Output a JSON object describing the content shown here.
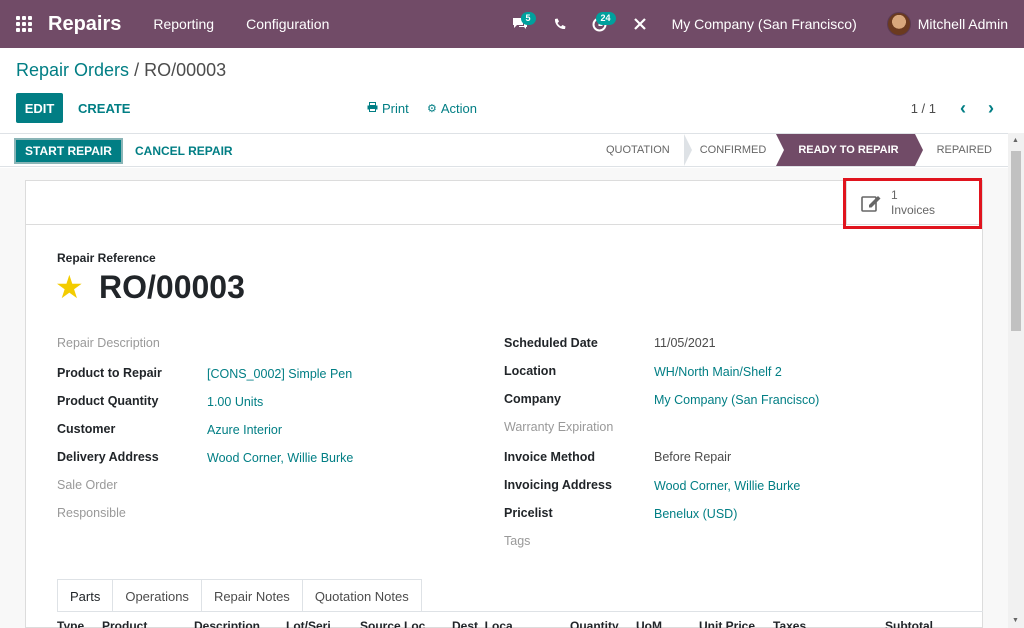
{
  "navbar": {
    "app_title": "Repairs",
    "menu": [
      "Reporting",
      "Configuration"
    ],
    "messages_badge": "5",
    "activities_badge": "24",
    "company": "My Company (San Francisco)",
    "user": "Mitchell Admin"
  },
  "breadcrumb": {
    "parent": "Repair Orders",
    "separator": "/",
    "current": "RO/00003"
  },
  "toolbar": {
    "edit": "EDIT",
    "create": "CREATE",
    "print": "Print",
    "action": "Action",
    "pager": "1 / 1"
  },
  "statusbar": {
    "start_repair": "START REPAIR",
    "cancel_repair": "CANCEL REPAIR",
    "stages": [
      {
        "label": "QUOTATION",
        "active": false
      },
      {
        "label": "CONFIRMED",
        "active": false
      },
      {
        "label": "READY TO REPAIR",
        "active": true
      },
      {
        "label": "REPAIRED",
        "active": false
      }
    ]
  },
  "smart_button": {
    "count": "1",
    "label": "Invoices"
  },
  "form": {
    "reference_label": "Repair Reference",
    "reference": "RO/00003",
    "left": [
      {
        "label": "Repair Description",
        "value": "",
        "muted": true,
        "link": false
      },
      {
        "label": "Product to Repair",
        "value": "[CONS_0002] Simple Pen",
        "muted": false,
        "link": true
      },
      {
        "label": "Product Quantity",
        "value": "1.00",
        "unit": "Units",
        "muted": false,
        "link": false
      },
      {
        "label": "Customer",
        "value": "Azure Interior",
        "muted": false,
        "link": true
      },
      {
        "label": "Delivery Address",
        "value": "Wood Corner, Willie Burke",
        "muted": false,
        "link": true
      },
      {
        "label": "Sale Order",
        "value": "",
        "muted": true,
        "link": false
      },
      {
        "label": "Responsible",
        "value": "",
        "muted": true,
        "link": false
      }
    ],
    "right": [
      {
        "label": "Scheduled Date",
        "value": "11/05/2021",
        "muted": false,
        "link": false
      },
      {
        "label": "Location",
        "value": "WH/North Main/Shelf 2",
        "muted": false,
        "link": true
      },
      {
        "label": "Company",
        "value": "My Company (San Francisco)",
        "muted": false,
        "link": true
      },
      {
        "label": "Warranty Expiration",
        "value": "",
        "muted": true,
        "link": false
      },
      {
        "label": "Invoice Method",
        "value": "Before Repair",
        "muted": false,
        "link": false
      },
      {
        "label": "Invoicing Address",
        "value": "Wood Corner, Willie Burke",
        "muted": false,
        "link": true
      },
      {
        "label": "Pricelist",
        "value": "Benelux (USD)",
        "muted": false,
        "link": true
      },
      {
        "label": "Tags",
        "value": "",
        "muted": true,
        "link": false
      }
    ]
  },
  "tabs": [
    "Parts",
    "Operations",
    "Repair Notes",
    "Quotation Notes"
  ],
  "table_columns": [
    "Type",
    "Product",
    "Description",
    "Lot/Seri",
    "Source Loc",
    "Dest. Loca",
    "Quantity",
    "UoM",
    "Unit Price",
    "Taxes",
    "Subtotal"
  ],
  "colors": {
    "brand": "#714b67",
    "accent": "#017e84",
    "highlight": "#e0141e",
    "star": "#f3cc00"
  }
}
